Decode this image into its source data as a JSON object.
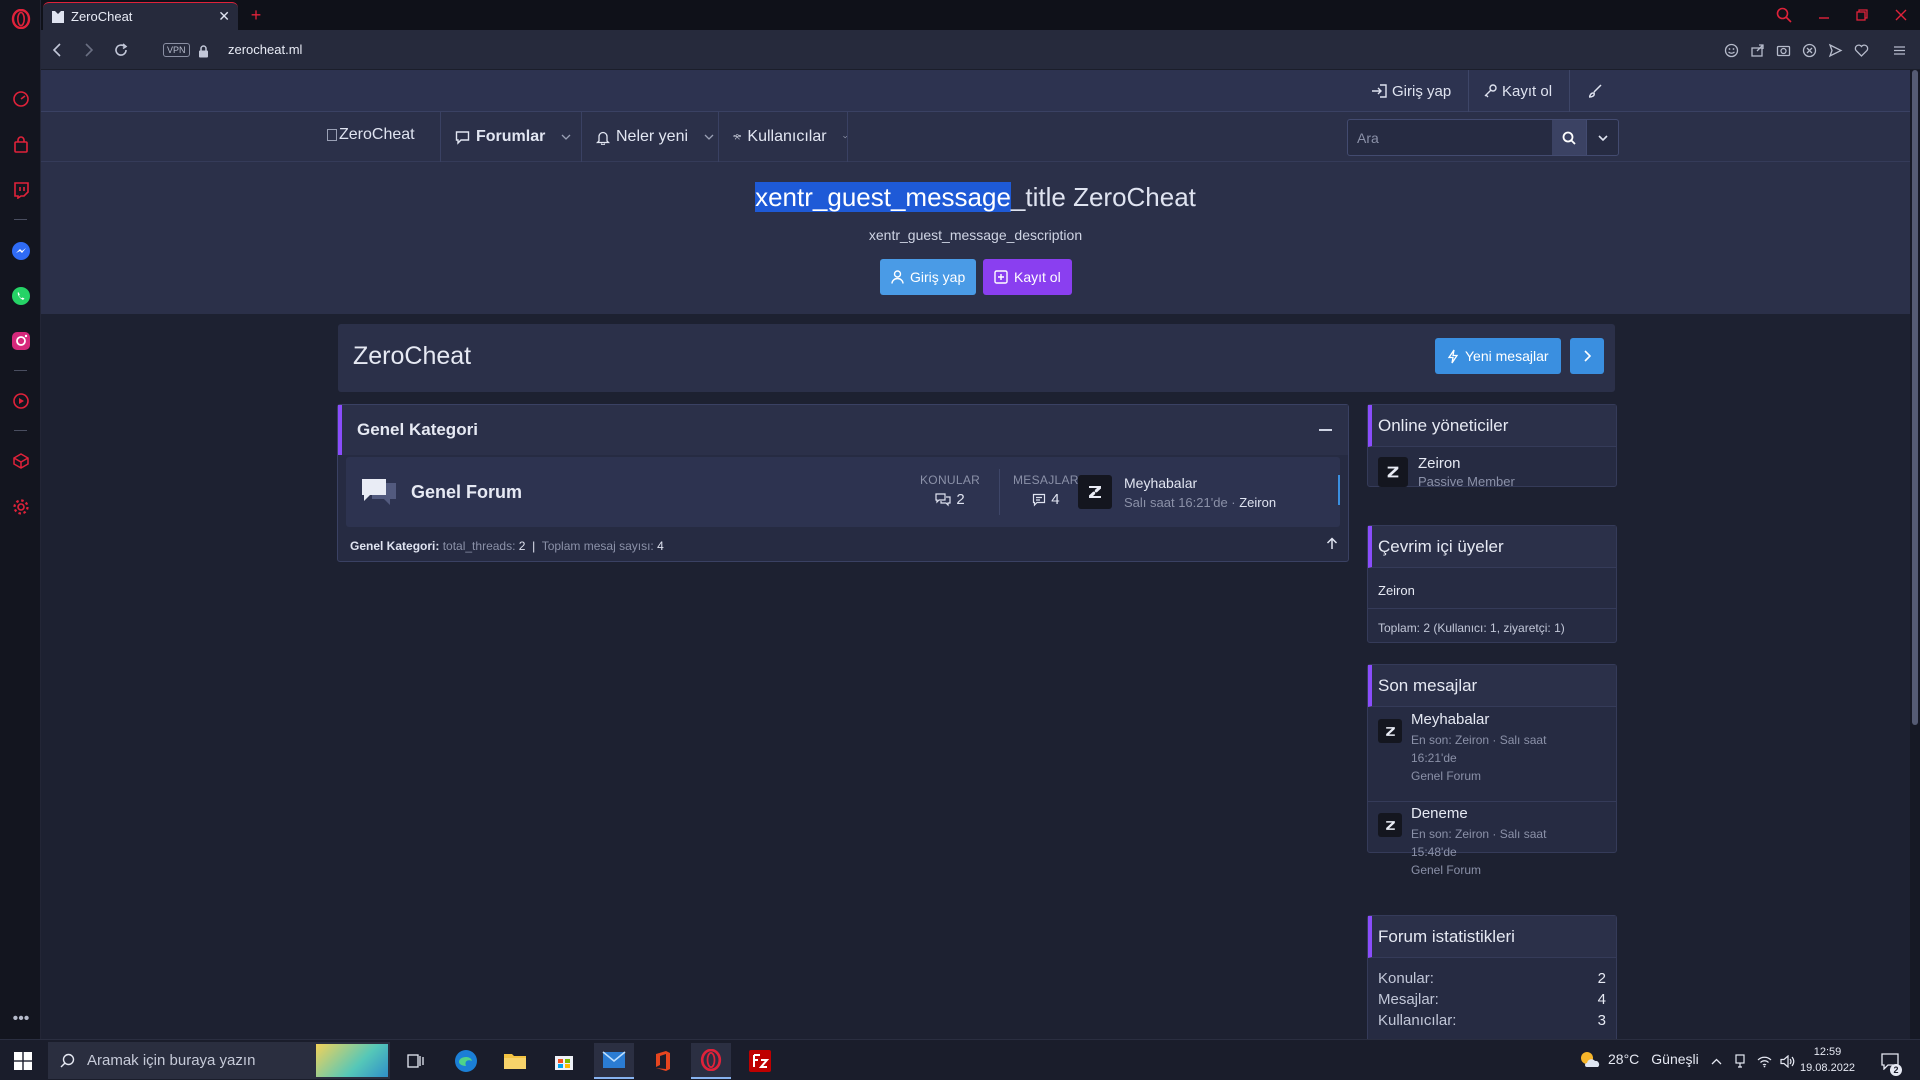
{
  "browser": {
    "tab_title": "ZeroCheat",
    "new_tab_symbol": "+",
    "vpn_label": "VPN",
    "url": "zerocheat.ml"
  },
  "top_strip": {
    "login_label": "Giriş yap",
    "register_label": "Kayıt ol"
  },
  "nav": {
    "logo_alt": "ZeroCheat",
    "items": [
      {
        "label": "Forumlar",
        "icon": "comment-icon"
      },
      {
        "label": "Neler yeni",
        "icon": "bell-icon"
      },
      {
        "label": "Kullanıcılar",
        "icon": "users-icon"
      }
    ],
    "search_placeholder": "Ara"
  },
  "guest": {
    "title_selected": "xentr_guest_message",
    "title_rest": "_title ZeroCheat",
    "description": "xentr_guest_message_description",
    "login_button": "Giriş yap",
    "register_button": "Kayıt ol",
    "login_color": "#4a9be6",
    "register_color": "#8a3ff0"
  },
  "main": {
    "title": "ZeroCheat",
    "new_messages_button": "Yeni mesajlar",
    "category": {
      "name": "Genel Kategori",
      "forum": {
        "name": "Genel Forum",
        "threads_label": "KONULAR",
        "threads": "2",
        "messages_label": "MESAJLAR",
        "messages": "4",
        "last_title": "Meyhabalar",
        "last_time": "Salı saat 16:21'de · ",
        "last_user": "Zeiron"
      },
      "footer_label": "Genel Kategori:",
      "footer_threads_label": "total_threads:",
      "footer_threads": "2",
      "footer_sep": "|",
      "footer_messages_label": "Toplam mesaj sayısı:",
      "footer_messages": "4"
    }
  },
  "sidebar": {
    "online_staff": {
      "title": "Online yöneticiler",
      "user": "Zeiron",
      "role": "Passive Member"
    },
    "online_members": {
      "title": "Çevrim içi üyeler",
      "user": "Zeiron",
      "total": "Toplam: 2 (Kullanıcı: 1, ziyaretçi: 1)"
    },
    "latest": {
      "title": "Son mesajlar",
      "items": [
        {
          "title": "Meyhabalar",
          "meta1": "En son: Zeiron · Salı saat",
          "meta2": "16:21'de",
          "forum": "Genel Forum"
        },
        {
          "title": "Deneme",
          "meta1": "En son: Zeiron · Salı saat",
          "meta2": "15:48'de",
          "forum": "Genel Forum"
        }
      ]
    },
    "stats": {
      "title": "Forum istatistikleri",
      "rows": [
        {
          "label": "Konular:",
          "value": "2"
        },
        {
          "label": "Mesajlar:",
          "value": "4"
        },
        {
          "label": "Kullanıcılar:",
          "value": "3"
        }
      ]
    }
  },
  "taskbar": {
    "search_placeholder": "Aramak için buraya yazın",
    "temperature": "28°C",
    "weather": "Güneşli",
    "time": "12:59",
    "date": "19.08.2022"
  },
  "colors": {
    "accent_purple": "#8a4dfc",
    "accent_blue": "#3a8fe0",
    "opera_red": "#e0223a"
  }
}
